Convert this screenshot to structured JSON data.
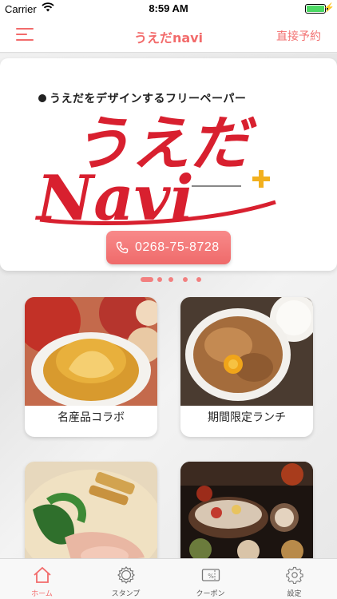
{
  "status_bar": {
    "carrier": "Carrier",
    "time": "8:59 AM",
    "battery_level": 1.0
  },
  "nav": {
    "title": "うえだnavi",
    "right_action": "直接予約",
    "menu_icon": "hamburger-menu-icon",
    "accent_color": "#f26b6b"
  },
  "banner": {
    "tagline": "うえだをデザインするフリーペーパー",
    "logo_line1": "うえだ",
    "logo_line2": "Navi",
    "phone_icon": "phone-icon",
    "phone": "0268-75-8728"
  },
  "carousel": {
    "page_count": 5,
    "current_page": 1
  },
  "cards": [
    {
      "label": "名産品コラボ"
    },
    {
      "label": "期間限定ランチ"
    },
    {
      "label": ""
    },
    {
      "label": ""
    }
  ],
  "tabs": [
    {
      "label": "ホーム",
      "icon": "home-icon",
      "active": true
    },
    {
      "label": "スタンプ",
      "icon": "stamp-icon",
      "active": false
    },
    {
      "label": "クーポン",
      "icon": "coupon-icon",
      "active": false
    },
    {
      "label": "設定",
      "icon": "gear-icon",
      "active": false
    }
  ]
}
